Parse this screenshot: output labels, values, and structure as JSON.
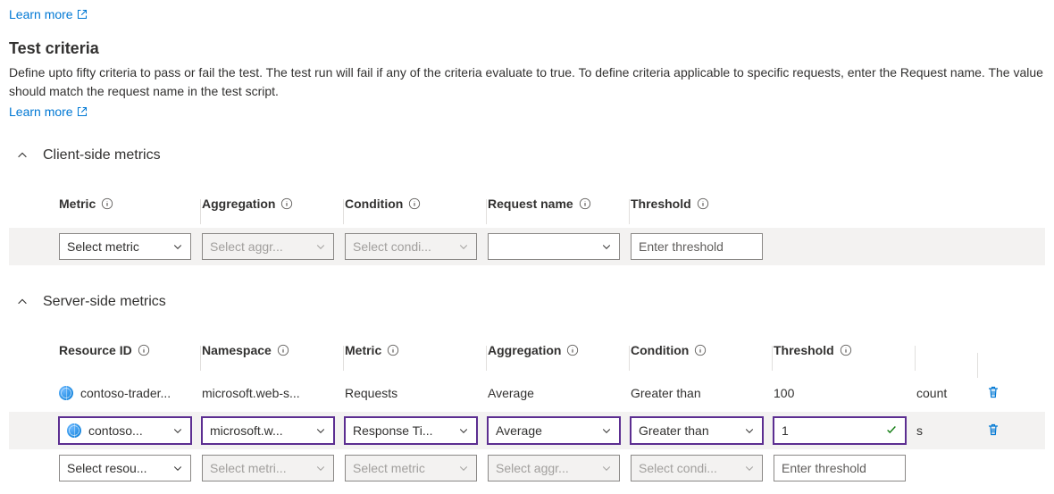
{
  "links": {
    "learn_more": "Learn more"
  },
  "section": {
    "title": "Test criteria",
    "description": "Define upto fifty criteria to pass or fail the test. The test run will fail if any of the criteria evaluate to true. To define criteria applicable to specific requests, enter the Request name. The value should match the request name in the test script."
  },
  "accordions": {
    "client_side": "Client-side metrics",
    "server_side": "Server-side metrics"
  },
  "client_headers": {
    "metric": "Metric",
    "aggregation": "Aggregation",
    "condition": "Condition",
    "request_name": "Request name",
    "threshold": "Threshold"
  },
  "client_row": {
    "metric_placeholder": "Select metric",
    "aggregation_placeholder": "Select aggr...",
    "condition_placeholder": "Select condi...",
    "request_name_value": "",
    "threshold_placeholder": "Enter threshold"
  },
  "server_headers": {
    "resource_id": "Resource ID",
    "namespace": "Namespace",
    "metric": "Metric",
    "aggregation": "Aggregation",
    "condition": "Condition",
    "threshold": "Threshold"
  },
  "server_rows": [
    {
      "resource_id": "contoso-trader...",
      "namespace": "microsoft.web-s...",
      "metric": "Requests",
      "aggregation": "Average",
      "condition": "Greater than",
      "threshold": "100",
      "unit": "count"
    },
    {
      "resource_id": "contoso...",
      "namespace": "microsoft.w...",
      "metric": "Response Ti...",
      "aggregation": "Average",
      "condition": "Greater than",
      "threshold": "1",
      "unit": "s"
    }
  ],
  "server_new_row": {
    "resource_placeholder": "Select resou...",
    "namespace_placeholder": "Select metri...",
    "metric_placeholder": "Select metric",
    "aggregation_placeholder": "Select aggr...",
    "condition_placeholder": "Select condi...",
    "threshold_placeholder": "Enter threshold"
  }
}
